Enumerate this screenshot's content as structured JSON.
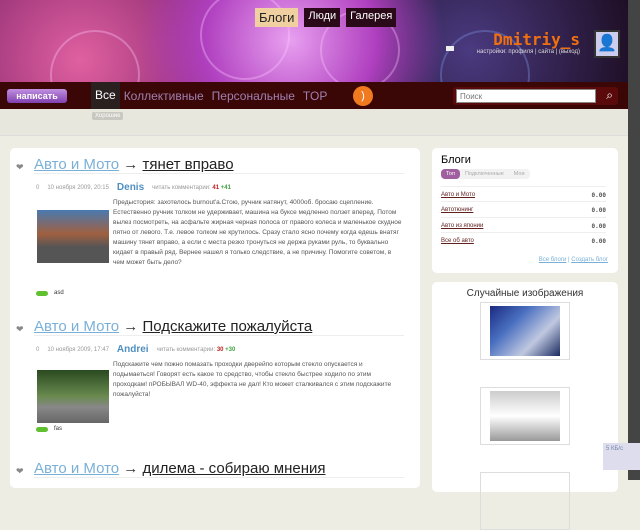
{
  "header": {
    "top_nav": [
      "Блоги",
      "Люди",
      "Галерея"
    ],
    "username": "Dmitriy_s",
    "user_links": "настройки: профиля | сайта | (выход)"
  },
  "nav": {
    "write_button": "написать",
    "tabs": [
      "Все",
      "Коллективные",
      "Персональные",
      "TOP"
    ],
    "search_placeholder": "Поиск",
    "subtab": "Хорошие"
  },
  "posts": [
    {
      "blog": "Авто и Мото",
      "arrow": "→",
      "title": "тянет вправо",
      "votes": "0",
      "date": "10 ноября 2009, 20:15",
      "author": "Denis",
      "comments_label": "читать комментарии:",
      "comments": "41",
      "new_comments": "+41",
      "text": "Предыстория: захотелось burnout'a.Стою, ручник натянут, 4000об. бросаю сцепление. Естественно ручник толком не удерживает, машина на буксе медленно ползет вперед. Потом вылез посмотреть, на асфальте жирная черная полоса от правого колеса и маленькое скудное пятно от левого. Т.е. левое толком не крутилось. Сразу стало ясно почему когда едешь внатяг машину тянет вправо, а если с места резко тронуться не держа руками руль, то буквально кидает в правый ряд. Вернее нашел я только следствие, а не причину. Помогите советом, в чем может быть дело?",
      "tag": "asd"
    },
    {
      "blog": "Авто и Мото",
      "arrow": "→",
      "title": "Подскажите пожалуйста",
      "votes": "0",
      "date": "10 ноября 2009, 17:47",
      "author": "Andrei",
      "comments_label": "читать комментарии:",
      "comments": "30",
      "new_comments": "+30",
      "text": "Подскажите чем пожно помазать проходки дверейпо которым стекло опускается и подымаеться! Говорят есть какое то средство, чтобы стекло быстрее ходило по этим проходкам! пРОБЫВАЛ WD-40, эффекта не дал! Кто может сталкивался с этим подскажите пожалуйста!",
      "tag": "fas"
    },
    {
      "blog": "Авто и Мото",
      "arrow": "→",
      "title": "дилема - собираю мнения"
    }
  ],
  "sidebar": {
    "blogs_title": "Блоги",
    "blog_tabs": [
      "Топ",
      "Подключенные",
      "Мои"
    ],
    "blogs": [
      {
        "name": "Авто и Мото",
        "rating": "0.00"
      },
      {
        "name": "Автотюнинг",
        "rating": "0.00"
      },
      {
        "name": "Авто из японии",
        "rating": "0.00"
      },
      {
        "name": "Все об авто",
        "rating": "0.00"
      }
    ],
    "all_blogs": "Все блоги",
    "create_blog": "Создать блог",
    "random_title": "Случайные изображения"
  },
  "speed": "5 КБ/с"
}
